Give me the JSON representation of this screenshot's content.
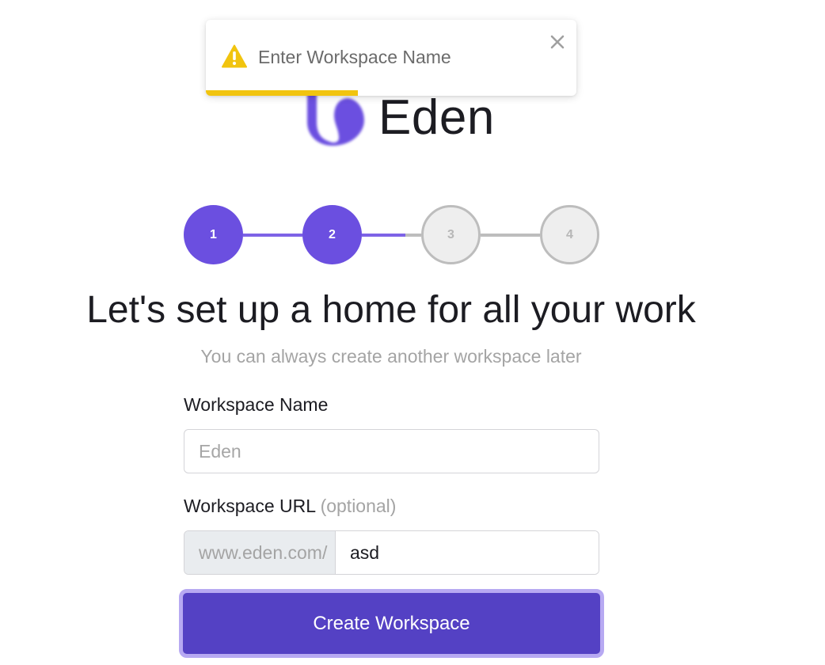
{
  "toast": {
    "message": "Enter Workspace Name",
    "icon": "warning-icon",
    "close_icon": "close-icon",
    "progress_fraction": 0.41,
    "accent_color": "#f1c40f"
  },
  "brand": {
    "name": "Eden",
    "logo_color": "#6b4fe0"
  },
  "stepper": {
    "steps": [
      {
        "label": "1",
        "state": "complete"
      },
      {
        "label": "2",
        "state": "current"
      },
      {
        "label": "3",
        "state": "pending"
      },
      {
        "label": "4",
        "state": "pending"
      }
    ],
    "active_color": "#6b4fe0",
    "pending_color": "#bdbdbd"
  },
  "heading": {
    "title": "Let's set up a home for all your work",
    "subtitle": "You can always create another workspace later"
  },
  "form": {
    "workspace_name": {
      "label": "Workspace Name",
      "placeholder": "Eden",
      "value": ""
    },
    "workspace_url": {
      "label": "Workspace URL",
      "optional": "(optional)",
      "prefix": "www.eden.com/",
      "value": "asd"
    },
    "submit_label": "Create Workspace",
    "button_color": "#5441c4"
  }
}
